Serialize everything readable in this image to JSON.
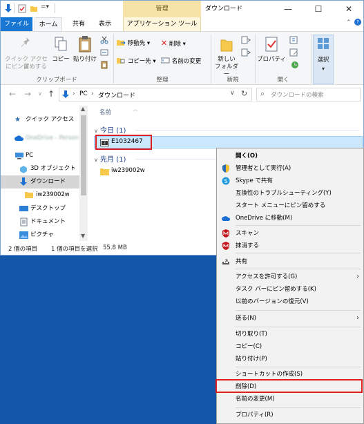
{
  "window": {
    "title": "ダウンロード",
    "manage_tab": "管理",
    "caption": {
      "minimize": "—",
      "maximize": "☐",
      "close": "✕"
    }
  },
  "ribbon": {
    "tabs": {
      "file": "ファイル",
      "home": "ホーム",
      "share": "共有",
      "view": "表示",
      "apptools": "アプリケーション ツール"
    },
    "clipboard": {
      "pin_line1": "クイック アクセス",
      "pin_line2": "にピン留めする",
      "copy": "コピー",
      "paste": "貼り付け",
      "label": "クリップボード"
    },
    "organize": {
      "move_to": "移動先 ▾",
      "copy_to": "コピー先 ▾",
      "delete": "削除 ▾",
      "rename": "名前の変更",
      "label": "整理"
    },
    "new": {
      "new_folder_line1": "新しい",
      "new_folder_line2": "フォルダー",
      "label": "新規"
    },
    "open": {
      "properties": "プロパティ",
      "label": "開く"
    },
    "select": {
      "label": "選択"
    }
  },
  "address": {
    "path": [
      "PC",
      "ダウンロード"
    ],
    "search_placeholder": "ダウンロードの検索"
  },
  "nav": {
    "items": [
      {
        "label": "クイック アクセス"
      },
      {
        "label": "OneDrive - Person"
      },
      {
        "label": "PC"
      },
      {
        "label": "3D オブジェクト"
      },
      {
        "label": "ダウンロード"
      },
      {
        "label": "iw239002w"
      },
      {
        "label": "デスクトップ"
      },
      {
        "label": "ドキュメント"
      },
      {
        "label": "ピクチャ"
      }
    ]
  },
  "files": {
    "column_name": "名前",
    "groups": [
      {
        "label": "今日 (1)",
        "items": [
          "E1032467"
        ]
      },
      {
        "label": "先月 (1)",
        "items": [
          "iw239002w"
        ]
      }
    ]
  },
  "status": {
    "count": "2 個の項目",
    "selected": "1 個の項目を選択",
    "size": "55.8 MB"
  },
  "context_menu": {
    "items": [
      "開く(O)",
      "管理者として実行(A)",
      "Skype で共有",
      "互換性のトラブルシューティング(Y)",
      "スタート メニューにピン留めする",
      "OneDrive に移動(M)",
      "スキャン",
      "抹消する",
      "共有",
      "アクセスを許可する(G)",
      "タスク バーにピン留めする(K)",
      "以前のバージョンの復元(V)",
      "送る(N)",
      "切り取り(T)",
      "コピー(C)",
      "貼り付け(P)",
      "ショートカットの作成(S)",
      "削除(D)",
      "名前の変更(M)",
      "プロパティ(R)"
    ]
  },
  "colors": {
    "accent": "#1976d2",
    "selection": "#cce8ff",
    "highlight_box": "#e21d1d",
    "desktop": "#1457a8"
  }
}
